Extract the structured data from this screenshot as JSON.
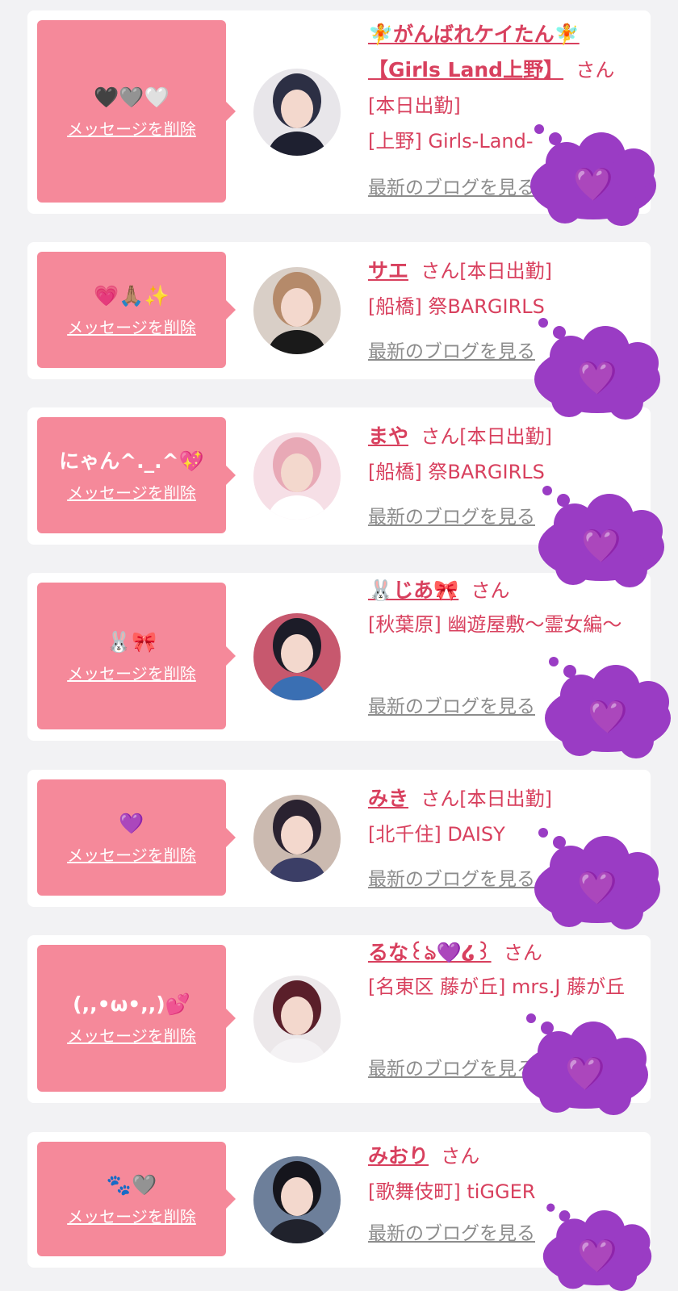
{
  "messages": [
    {
      "message_text": "🖤🩶🤍",
      "delete_label": "メッセージを削除",
      "name": "🧚がんばれケイたん🧚【Girls Land上野】",
      "honorific": "さん",
      "status": "[本日出勤]",
      "shop": "[上野] Girls-Land-",
      "blog_label": "最新のブログを見る",
      "avatar_colors": {
        "hair": "#2c2f44",
        "bg": "#e8e6ea",
        "cloth": "#1e2030"
      }
    },
    {
      "message_text": "💗🙏🏽✨",
      "delete_label": "メッセージを削除",
      "name": "サエ",
      "honorific": "さん",
      "status": "[本日出勤]",
      "shop": "[船橋] 祭BARGIRLS",
      "blog_label": "最新のブログを見る",
      "avatar_colors": {
        "hair": "#b58a6a",
        "bg": "#d9cfc7",
        "cloth": "#1a1a1a"
      }
    },
    {
      "message_text": "にゃん^._.^💖",
      "delete_label": "メッセージを削除",
      "name": "まや",
      "honorific": "さん",
      "status": "[本日出勤]",
      "shop": "[船橋] 祭BARGIRLS",
      "blog_label": "最新のブログを見る",
      "avatar_colors": {
        "hair": "#e8a9b6",
        "bg": "#f6dfe6",
        "cloth": "#ffffff"
      }
    },
    {
      "message_text": "🐰🎀",
      "delete_label": "メッセージを削除",
      "name": "🐰じあ🎀",
      "honorific": "さん",
      "status": "",
      "shop": "[秋葉原] 幽遊屋敷～霊女編～",
      "blog_label": "最新のブログを見る",
      "avatar_colors": {
        "hair": "#1c1c28",
        "bg": "#c7586e",
        "cloth": "#3a6fb3"
      }
    },
    {
      "message_text": "💜",
      "delete_label": "メッセージを削除",
      "name": "みき",
      "honorific": "さん",
      "status": "[本日出勤]",
      "shop": "[北千住] DAISY",
      "blog_label": "最新のブログを見る",
      "avatar_colors": {
        "hair": "#2a2230",
        "bg": "#cbbab0",
        "cloth": "#3b3e66"
      }
    },
    {
      "message_text": "(,,•ω•,,)💕",
      "delete_label": "メッセージを削除",
      "name": "るな꒰ঌ💜໒꒱",
      "honorific": "さん",
      "status": "",
      "shop": "[名東区 藤が丘] mrs.J 藤が丘",
      "blog_label": "最新のブログを見る",
      "avatar_colors": {
        "hair": "#5a1f2a",
        "bg": "#ece8ea",
        "cloth": "#f4f2f4"
      }
    },
    {
      "message_text": "🐾🩶",
      "delete_label": "メッセージを削除",
      "name": "みおり",
      "honorific": "さん",
      "status": "",
      "shop": "[歌舞伎町] tiGGER",
      "blog_label": "最新のブログを見る",
      "avatar_colors": {
        "hair": "#15151c",
        "bg": "#6d7f9a",
        "cloth": "#20222c"
      }
    }
  ],
  "overlay": {
    "heart": "💜",
    "color": "#9a3cc4"
  }
}
